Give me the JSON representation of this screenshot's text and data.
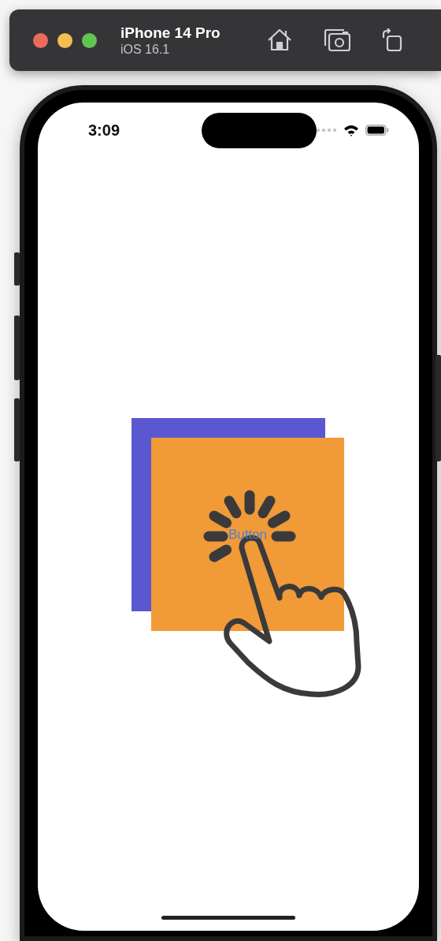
{
  "toolbar": {
    "device_name": "iPhone 14 Pro",
    "os_version": "iOS 16.1"
  },
  "status_bar": {
    "time": "3:09"
  },
  "screen": {
    "button": {
      "label": "Button"
    }
  }
}
